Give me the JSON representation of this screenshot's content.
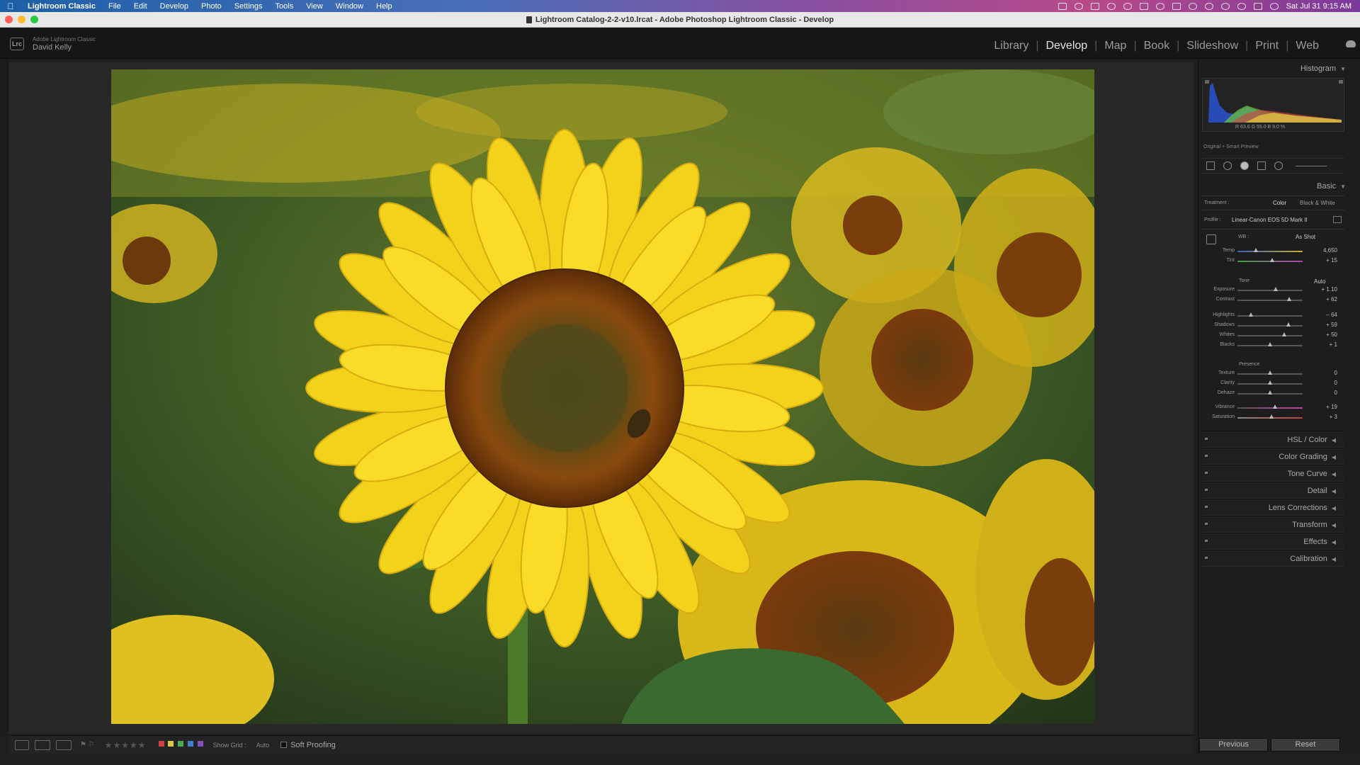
{
  "menubar": {
    "app_name": "Lightroom Classic",
    "items": [
      "File",
      "Edit",
      "Develop",
      "Photo",
      "Settings",
      "Tools",
      "View",
      "Window",
      "Help"
    ],
    "clock": "Sat Jul 31  9:15 AM"
  },
  "window": {
    "title": "Lightroom Catalog-2-2-v10.lrcat - Adobe Photoshop Lightroom Classic - Develop"
  },
  "identity": {
    "logo": "Lrc",
    "brand": "Adobe Lightroom Classic",
    "user": "David Kelly"
  },
  "modules": [
    "Library",
    "Develop",
    "Map",
    "Book",
    "Slideshow",
    "Print",
    "Web"
  ],
  "active_module": "Develop",
  "histogram": {
    "title": "Histogram",
    "values": "R  63.6  G  55.0  B  9.0 %",
    "preview": "Original + Smart Preview"
  },
  "basic": {
    "title": "Basic",
    "treatment_label": "Treatment :",
    "treatment_color": "Color",
    "treatment_bw": "Black & White",
    "profile_label": "Profile :",
    "profile_value": "Linear-Canon EOS 5D Mark II",
    "wb_label": "WB :",
    "wb_value": "As Shot",
    "temp": {
      "label": "Temp",
      "value": "4,650",
      "pos": 0.28
    },
    "tint": {
      "label": "Tint",
      "value": "+ 15",
      "pos": 0.53
    },
    "tone_label": "Tone",
    "auto_label": "Auto",
    "exposure": {
      "label": "Exposure",
      "value": "+ 1.10",
      "pos": 0.59
    },
    "contrast": {
      "label": "Contrast",
      "value": "+ 62",
      "pos": 0.79
    },
    "highlights": {
      "label": "Highlights",
      "value": "– 64",
      "pos": 0.21
    },
    "shadows": {
      "label": "Shadows",
      "value": "+ 59",
      "pos": 0.78
    },
    "whites": {
      "label": "Whites",
      "value": "+ 50",
      "pos": 0.72
    },
    "blacks": {
      "label": "Blacks",
      "value": "+ 1",
      "pos": 0.5
    },
    "presence_label": "Presence",
    "texture": {
      "label": "Texture",
      "value": "0",
      "pos": 0.5
    },
    "clarity": {
      "label": "Clarity",
      "value": "0",
      "pos": 0.5
    },
    "dehaze": {
      "label": "Dehaze",
      "value": "0",
      "pos": 0.5
    },
    "vibrance": {
      "label": "Vibrance",
      "value": "+ 19",
      "pos": 0.58
    },
    "saturation": {
      "label": "Saturation",
      "value": "+ 3",
      "pos": 0.52
    }
  },
  "panels": [
    "HSL / Color",
    "Color Grading",
    "Tone Curve",
    "Detail",
    "Lens Corrections",
    "Transform",
    "Effects",
    "Calibration"
  ],
  "toolbar": {
    "show_grid": "Show Grid :",
    "auto": "Auto",
    "soft_proofing": "Soft Proofing",
    "label_colors": [
      "#d04040",
      "#d8c840",
      "#40b050",
      "#4080d0",
      "#8050c0"
    ]
  },
  "footer": {
    "previous": "Previous",
    "reset": "Reset"
  }
}
